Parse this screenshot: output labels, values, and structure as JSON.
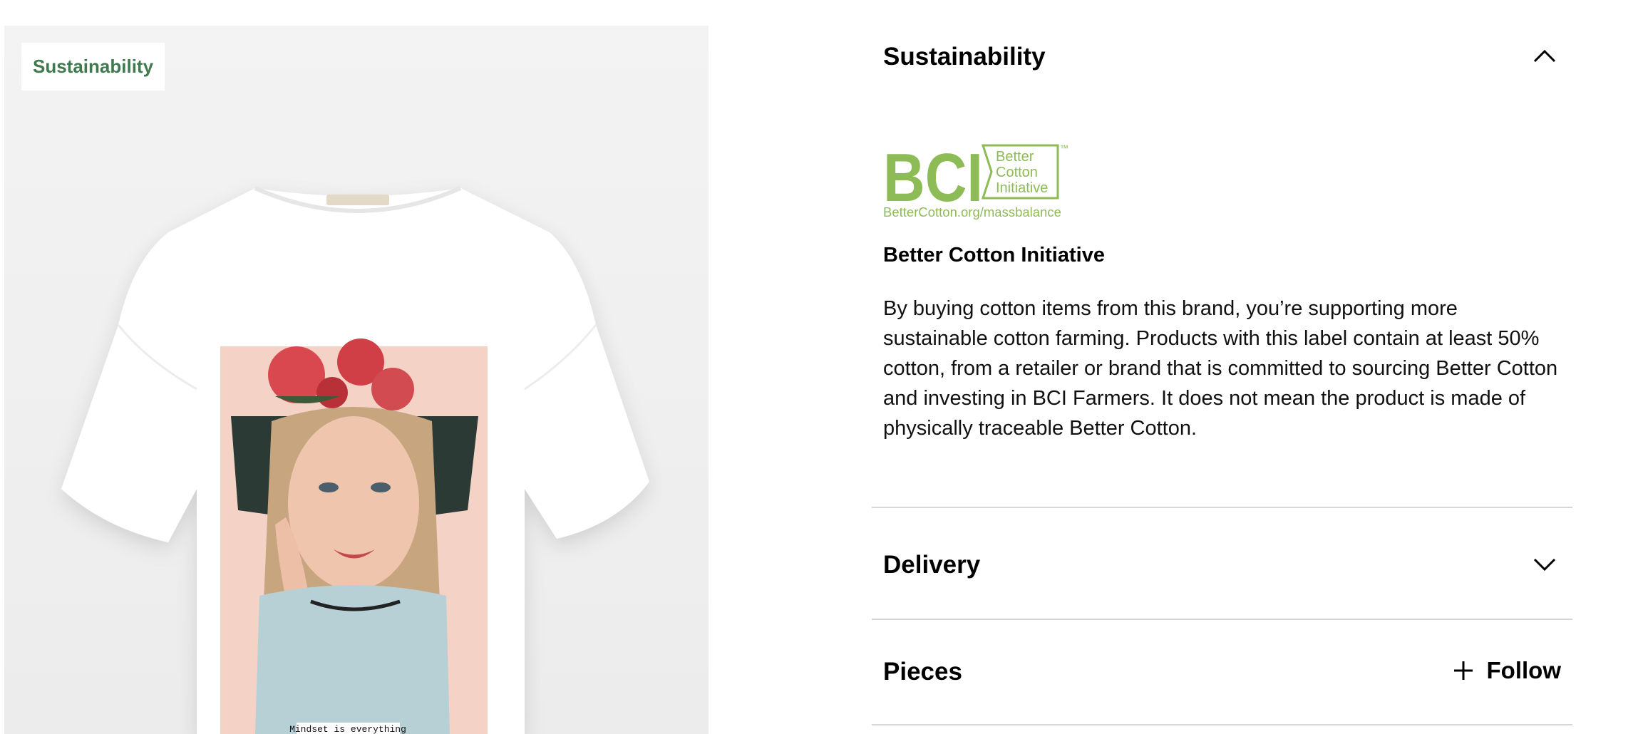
{
  "product": {
    "badge_label": "Sustainability",
    "print_caption": "Mindset is everything"
  },
  "accordion": {
    "sustainability": {
      "title": "Sustainability",
      "expanded": true,
      "logo": {
        "letters": "BCI",
        "line1": "Better",
        "line2": "Cotton",
        "line3": "Initiative",
        "tm": "™",
        "url_text": "BetterCotton.org/massbalance",
        "color": "#8dbb55"
      },
      "heading": "Better Cotton Initiative",
      "description": "By buying cotton items from this brand, you’re supporting more sustainable cotton farming. Products with this label contain at least 50% cotton, from a retailer or brand that is committed to sourcing Better Cotton and investing in BCI Farmers. It does not mean the product is made of physically traceable Better Cotton."
    },
    "delivery": {
      "title": "Delivery",
      "expanded": false
    },
    "pieces": {
      "title": "Pieces",
      "follow_label": "Follow"
    }
  }
}
